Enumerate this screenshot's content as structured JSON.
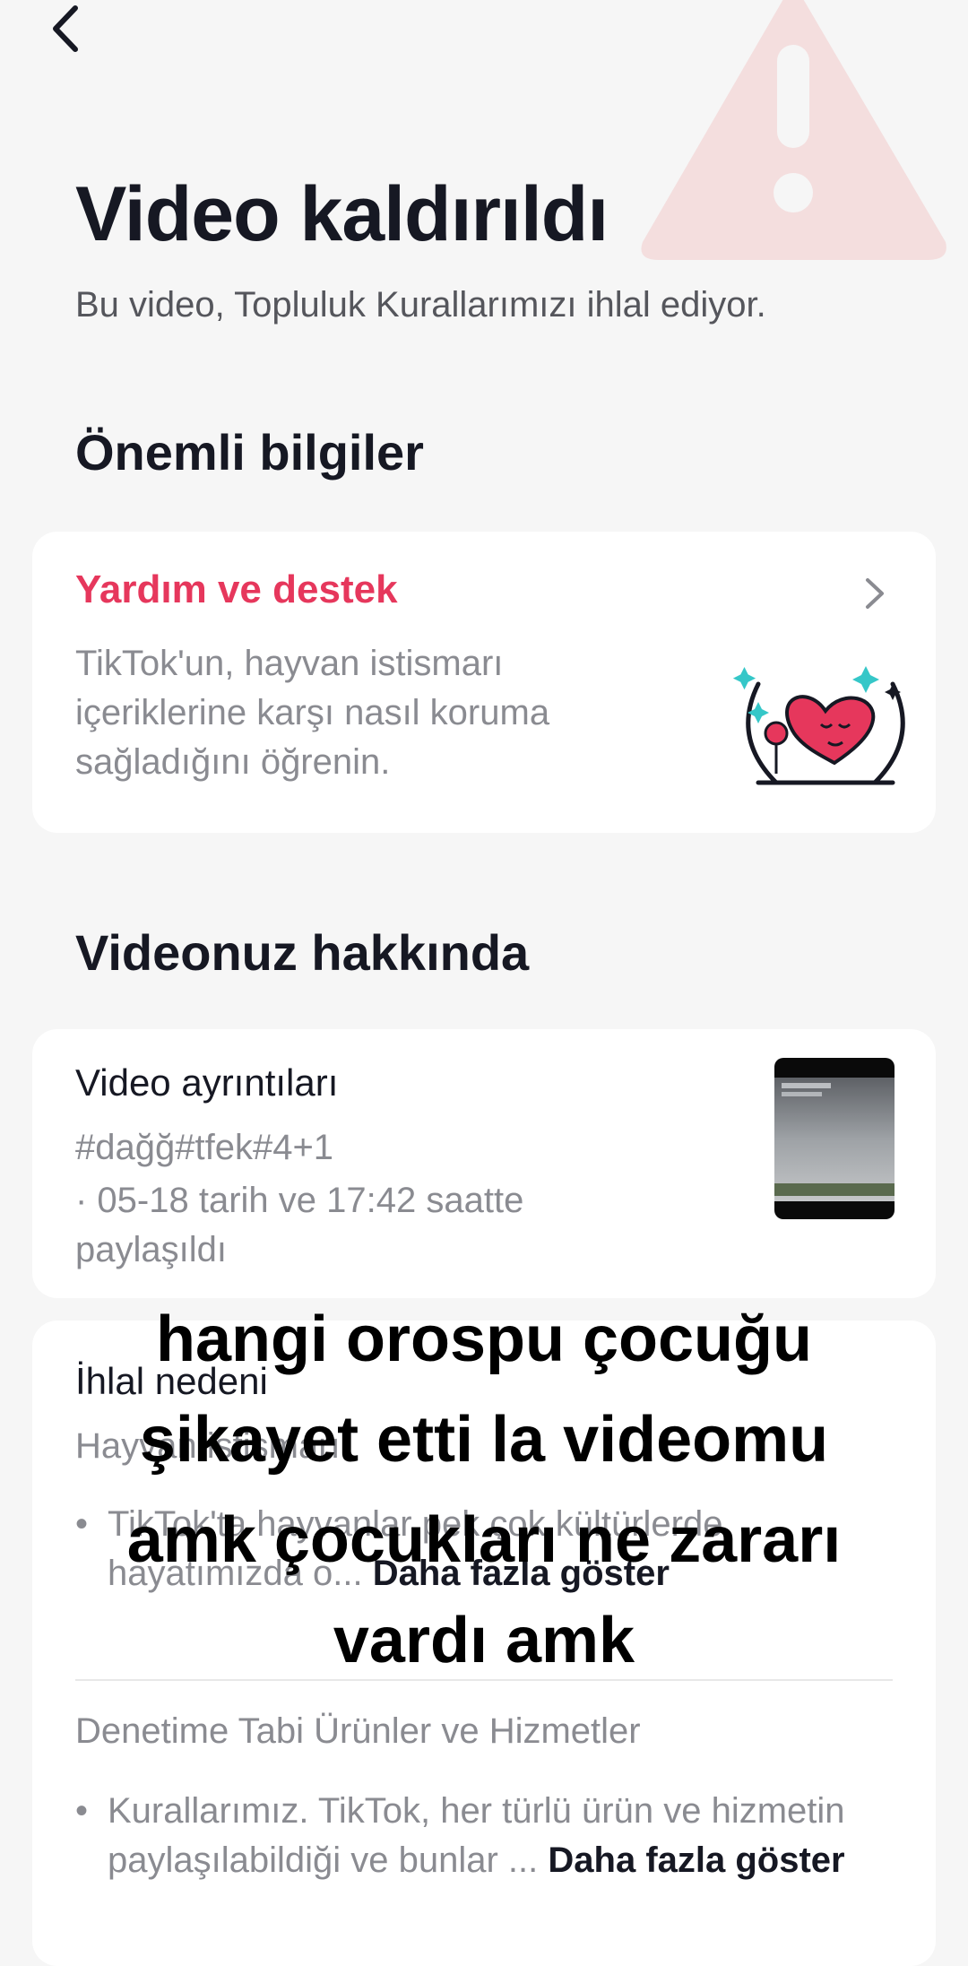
{
  "header": {
    "back_icon": "chevron-left-icon",
    "title": "Video kaldırıldı",
    "subtitle": "Bu video, Topluluk Kurallarımızı ihlal ediyor.",
    "background_icon": "warning-triangle-icon"
  },
  "important_info": {
    "section_title": "Önemli bilgiler",
    "help_card": {
      "title": "Yardım ve destek",
      "description": "TikTok'un, hayvan istismarı içeriklerine karşı nasıl koruma sağladığını öğrenin.",
      "chevron_icon": "chevron-right-icon",
      "illustration": "heart-hug-illustration"
    }
  },
  "about_video": {
    "section_title": "Videonuz hakkında",
    "details": {
      "title": "Video ayrıntıları",
      "tags": "#dağğ#tfek#4+1",
      "date": "· 05-18 tarih ve 17:42 saatte paylaşıldı"
    },
    "violation": {
      "title": "İhlal nedeni",
      "subtitle": "Hayvan istismarı",
      "bullet1": "TikTok'ta hayvanlar pek çok kültürlerde hayatımızda o...",
      "more1": "Daha fazla göster",
      "category": "Denetime Tabi Ürünler ve Hizmetler",
      "bullet2": "Kurallarımız. TikTok, her türlü ürün ve hizmetin paylaşılabildiği ve bunlar ...",
      "more2": "Daha fazla göster"
    }
  },
  "overlay_caption": {
    "line1": "hangi orospu çocuğu",
    "line2": "şikayet etti la videomu",
    "line3": "amk çocukları ne zararı",
    "line4": "vardı amk"
  },
  "colors": {
    "accent": "#e6375c",
    "background": "#f6f6f6",
    "card": "#ffffff",
    "secondary_text": "#8a8b91"
  }
}
